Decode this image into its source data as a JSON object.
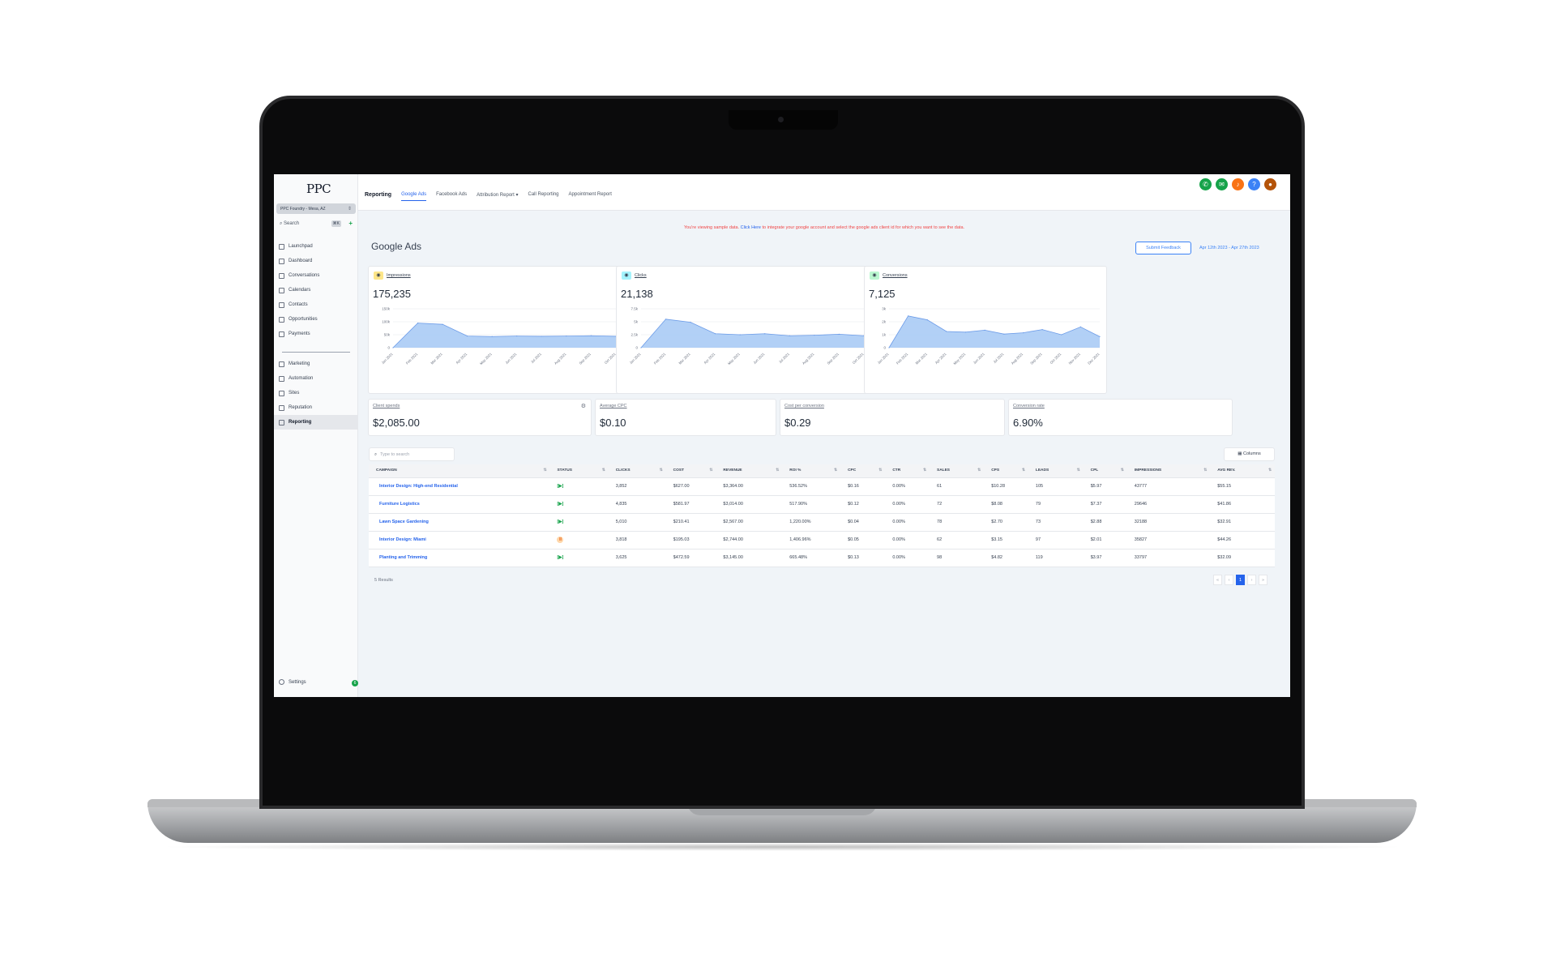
{
  "app": {
    "logo": "PPC",
    "location": "PPC Foundry - Mesa, AZ",
    "search_label": "Search",
    "search_shortcut": "⌘K"
  },
  "sidebar": {
    "items": [
      {
        "label": "Launchpad",
        "icon": "rocket-icon"
      },
      {
        "label": "Dashboard",
        "icon": "grid-icon"
      },
      {
        "label": "Conversations",
        "icon": "chat-icon"
      },
      {
        "label": "Calendars",
        "icon": "calendar-icon"
      },
      {
        "label": "Contacts",
        "icon": "contacts-icon"
      },
      {
        "label": "Opportunities",
        "icon": "target-icon"
      },
      {
        "label": "Payments",
        "icon": "receipt-icon"
      }
    ],
    "items2": [
      {
        "label": "Marketing",
        "icon": "send-icon"
      },
      {
        "label": "Automation",
        "icon": "automation-icon"
      },
      {
        "label": "Sites",
        "icon": "globe-icon"
      },
      {
        "label": "Reputation",
        "icon": "star-icon"
      },
      {
        "label": "Reporting",
        "icon": "chart-icon"
      }
    ],
    "settings_label": "Settings",
    "settings_badge": "6"
  },
  "topbar": {
    "title": "Reporting",
    "tabs": [
      "Google Ads",
      "Facebook Ads",
      "Attribution Report ▾",
      "Call Reporting",
      "Appointment Report"
    ]
  },
  "notice": {
    "pre": "You're viewing sample data.",
    "link": "Click Here",
    "post": "to integrate your google account and select the google ads client id for which you want to see the data."
  },
  "page": {
    "title": "Google Ads",
    "feedback_label": "Submit Feedback",
    "date_range": "Apr 12th 2023 - Apr 27th 2023"
  },
  "cards": [
    {
      "label": "Impressions",
      "value": "175,235",
      "ticks": [
        "150k",
        "100k",
        "50k",
        "0"
      ],
      "badge_color": "#fde68a",
      "chart_color": "#a5c8f5"
    },
    {
      "label": "Clicks",
      "value": "21,138",
      "ticks": [
        "7.5k",
        "5k",
        "2.5k",
        "0"
      ],
      "badge_color": "#a5f3fc",
      "chart_color": "#a5c8f5"
    },
    {
      "label": "Conversions",
      "value": "7,125",
      "ticks": [
        "3k",
        "2k",
        "1k",
        "0"
      ],
      "badge_color": "#bbf7d0",
      "chart_color": "#a5c8f5"
    }
  ],
  "chart_data": [
    {
      "type": "area",
      "x": [
        "Jan 2021",
        "Feb 2021",
        "Mar 2021",
        "Apr 2021",
        "May 2021",
        "Jun 2021",
        "Jul 2021",
        "Aug 2021",
        "Sep 2021",
        "Oct 2021",
        "Nov 2021",
        "Dec 2021"
      ],
      "values": [
        0,
        95000,
        90000,
        45000,
        43000,
        45000,
        44000,
        45000,
        46000,
        44000,
        46000,
        36000
      ],
      "ylim": [
        0,
        150000
      ]
    },
    {
      "type": "area",
      "x": [
        "Jan 2021",
        "Feb 2021",
        "Mar 2021",
        "Apr 2021",
        "May 2021",
        "Jun 2021",
        "Jul 2021",
        "Aug 2021",
        "Sep 2021",
        "Oct 2021",
        "Nov 2021",
        "Dec 2021"
      ],
      "values": [
        0,
        5500,
        4900,
        2700,
        2500,
        2700,
        2300,
        2400,
        2600,
        2300,
        2700,
        1900
      ],
      "ylim": [
        0,
        7500
      ]
    },
    {
      "type": "area",
      "x": [
        "Jan 2021",
        "Feb 2021",
        "Mar 2021",
        "Apr 2021",
        "May 2021",
        "Jun 2021",
        "Jul 2021",
        "Aug 2021",
        "Sep 2021",
        "Oct 2021",
        "Nov 2021",
        "Dec 2021"
      ],
      "values": [
        0,
        2450,
        2150,
        1250,
        1200,
        1350,
        1050,
        1150,
        1400,
        1000,
        1600,
        850
      ],
      "ylim": [
        0,
        3000
      ]
    }
  ],
  "metrics": [
    {
      "label": "Client spends",
      "value": "$2,085.00"
    },
    {
      "label": "Average CPC",
      "value": "$0.10"
    },
    {
      "label": "Cost per conversion",
      "value": "$0.29"
    },
    {
      "label": "Conversion rate",
      "value": "6.90%"
    }
  ],
  "table": {
    "search_placeholder": "Type to search",
    "columns_label": "Columns",
    "headers": [
      "CAMPAIGN",
      "STATUS",
      "CLICKS",
      "COST",
      "REVENUE",
      "ROI %",
      "CPC",
      "CTR",
      "SALES",
      "CPS",
      "LEADS",
      "CPL",
      "IMPRESSIONS",
      "AVG REV."
    ],
    "rows": [
      {
        "campaign": "Interior Design: High-end Residential",
        "status": "active",
        "clicks": "3,852",
        "cost": "$627.00",
        "revenue": "$3,364.00",
        "roi": "536.52%",
        "cpc": "$0.16",
        "ctr": "0.00%",
        "sales": "61",
        "cps": "$10.28",
        "leads": "105",
        "cpl": "$5.97",
        "impressions": "43777",
        "avg_rev": "$55.15"
      },
      {
        "campaign": "Furniture Logistics",
        "status": "active",
        "clicks": "4,835",
        "cost": "$581.97",
        "revenue": "$3,014.00",
        "roi": "517.90%",
        "cpc": "$0.12",
        "ctr": "0.00%",
        "sales": "72",
        "cps": "$8.08",
        "leads": "79",
        "cpl": "$7.37",
        "impressions": "29646",
        "avg_rev": "$41.86"
      },
      {
        "campaign": "Lawn Space Gardening",
        "status": "active",
        "clicks": "5,010",
        "cost": "$210.41",
        "revenue": "$2,567.00",
        "roi": "1,220.00%",
        "cpc": "$0.04",
        "ctr": "0.00%",
        "sales": "78",
        "cps": "$2.70",
        "leads": "73",
        "cpl": "$2.88",
        "impressions": "32188",
        "avg_rev": "$32.91"
      },
      {
        "campaign": "Interior Design: Miami",
        "status": "paused",
        "clicks": "3,818",
        "cost": "$195.03",
        "revenue": "$2,744.00",
        "roi": "1,406.96%",
        "cpc": "$0.05",
        "ctr": "0.00%",
        "sales": "62",
        "cps": "$3.15",
        "leads": "97",
        "cpl": "$2.01",
        "impressions": "35827",
        "avg_rev": "$44.26"
      },
      {
        "campaign": "Planting and Trimming",
        "status": "active",
        "clicks": "3,625",
        "cost": "$472.59",
        "revenue": "$3,145.00",
        "roi": "665.48%",
        "cpc": "$0.13",
        "ctr": "0.00%",
        "sales": "98",
        "cps": "$4.82",
        "leads": "119",
        "cpl": "$3.97",
        "impressions": "33797",
        "avg_rev": "$32.09"
      }
    ],
    "results_label": "5 Results",
    "page": "1"
  },
  "header_icons": [
    {
      "name": "phone-icon",
      "color": "#16a34a"
    },
    {
      "name": "megaphone-icon",
      "color": "#16a34a"
    },
    {
      "name": "bell-icon",
      "color": "#f97316"
    },
    {
      "name": "help-icon",
      "color": "#3b82f6"
    },
    {
      "name": "avatar",
      "color": "#b45309"
    }
  ]
}
